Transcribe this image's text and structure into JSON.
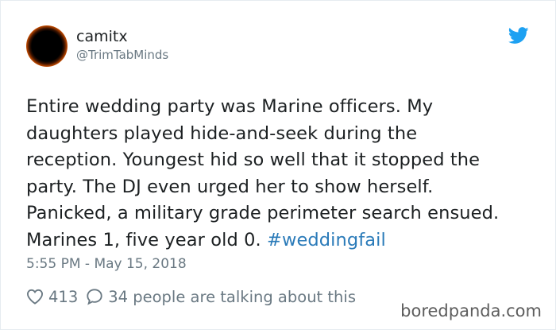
{
  "tweet": {
    "author_name": "camitx",
    "author_handle": "@TrimTabMinds",
    "text": "Entire wedding party was Marine officers. My\ndaughters played hide-and-seek during the\nreception. Youngest hid so well that it stopped the\nparty. The DJ even urged her to show herself.\nPanicked, a military grade perimeter search ensued.\nMarines 1, five year old 0.  ",
    "hashtag": "#weddingfail",
    "timestamp": "5:55 PM - May 15, 2018",
    "like_count": "413",
    "reply_text": "34 people are talking about this"
  },
  "icons": {
    "platform": "twitter-bird-icon",
    "like": "heart-icon",
    "reply": "speech-bubble-icon"
  },
  "colors": {
    "text": "#1c2022",
    "secondary": "#697882",
    "link": "#2b7bb9",
    "brand": "#1da1f2"
  },
  "watermark": "boredpanda.com"
}
